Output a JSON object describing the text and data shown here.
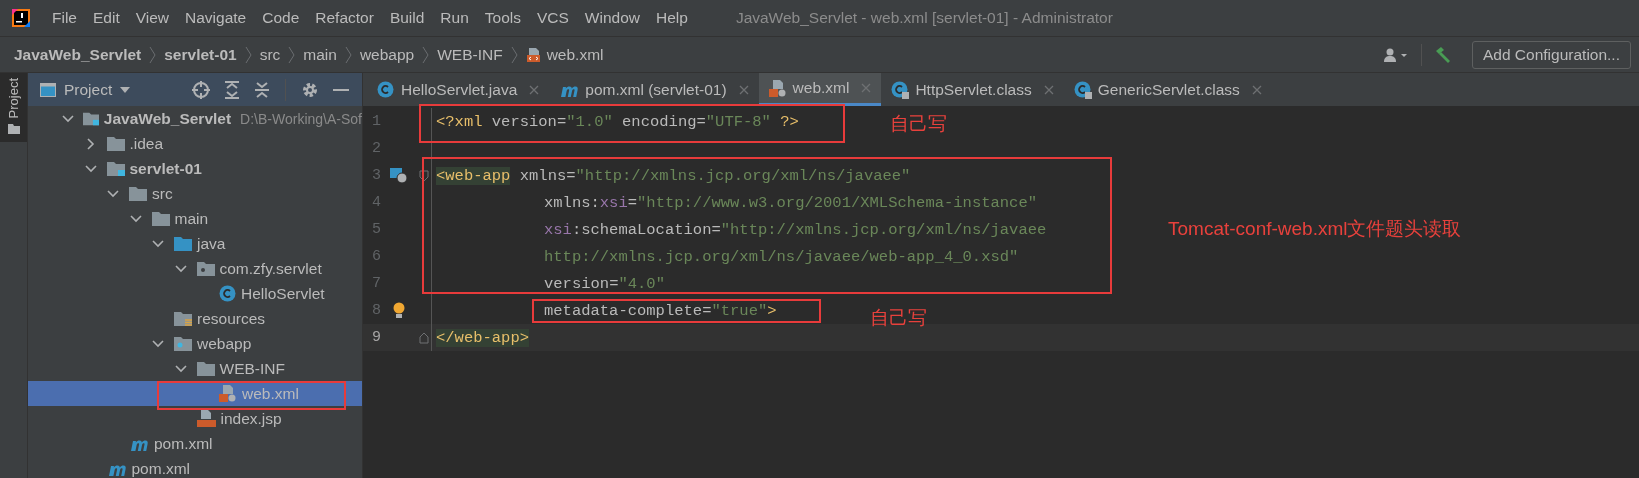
{
  "menu": {
    "items": [
      "File",
      "Edit",
      "View",
      "Navigate",
      "Code",
      "Refactor",
      "Build",
      "Run",
      "Tools",
      "VCS",
      "Window",
      "Help"
    ]
  },
  "window": {
    "title": "JavaWeb_Servlet - web.xml [servlet-01] - Administrator"
  },
  "breadcrumb": [
    {
      "label": "JavaWeb_Servlet",
      "kind": "module"
    },
    {
      "label": "servlet-01",
      "kind": "module"
    },
    {
      "label": "src",
      "kind": "folder"
    },
    {
      "label": "main",
      "kind": "folder"
    },
    {
      "label": "webapp",
      "kind": "folder"
    },
    {
      "label": "WEB-INF",
      "kind": "folder"
    },
    {
      "label": "web.xml",
      "kind": "xml"
    }
  ],
  "toolbar": {
    "run_config_button": "Add Configuration..."
  },
  "side_strip": {
    "tab": "Project"
  },
  "project_panel": {
    "title": "Project",
    "tree": [
      {
        "label": "JavaWeb_Servlet",
        "hint": "D:\\B-Working\\A-Sof",
        "kind": "module",
        "expanded": true,
        "selected": false,
        "children": [
          {
            "label": ".idea",
            "kind": "folder",
            "expanded": false,
            "selected": false
          },
          {
            "label": "servlet-01",
            "kind": "module",
            "expanded": true,
            "selected": false,
            "children": [
              {
                "label": "src",
                "kind": "folder",
                "expanded": true,
                "selected": false,
                "children": [
                  {
                    "label": "main",
                    "kind": "folder",
                    "expanded": true,
                    "selected": false,
                    "children": [
                      {
                        "label": "java",
                        "kind": "source-folder",
                        "expanded": true,
                        "selected": false,
                        "children": [
                          {
                            "label": "com.zfy.servlet",
                            "kind": "package",
                            "expanded": true,
                            "selected": false,
                            "children": [
                              {
                                "label": "HelloServlet",
                                "kind": "class",
                                "selected": false
                              }
                            ]
                          }
                        ]
                      },
                      {
                        "label": "resources",
                        "kind": "resources",
                        "selected": false
                      },
                      {
                        "label": "webapp",
                        "kind": "web-folder",
                        "expanded": true,
                        "selected": false,
                        "children": [
                          {
                            "label": "WEB-INF",
                            "kind": "folder",
                            "expanded": true,
                            "selected": false,
                            "children": [
                              {
                                "label": "web.xml",
                                "kind": "xml",
                                "selected": true
                              }
                            ]
                          },
                          {
                            "label": "index.jsp",
                            "kind": "jsp",
                            "selected": false
                          }
                        ]
                      }
                    ]
                  }
                ]
              },
              {
                "label": "pom.xml",
                "kind": "maven",
                "selected": false
              }
            ]
          },
          {
            "label": "pom.xml",
            "kind": "maven",
            "selected": false
          }
        ]
      }
    ]
  },
  "tabs": [
    {
      "label": "HelloServlet.java",
      "kind": "class",
      "selected": false
    },
    {
      "label": "pom.xml (servlet-01)",
      "kind": "maven",
      "selected": false
    },
    {
      "label": "web.xml",
      "kind": "xml",
      "selected": true
    },
    {
      "label": "HttpServlet.class",
      "kind": "class-locked",
      "selected": false
    },
    {
      "label": "GenericServlet.class",
      "kind": "class-locked",
      "selected": false
    }
  ],
  "editor": {
    "lines": [
      {
        "number": "1",
        "indented": false,
        "current": false,
        "tokens": [
          {
            "text": "<?xml ",
            "kind": "pi"
          },
          {
            "text": "version",
            "kind": "attr"
          },
          {
            "text": "=",
            "kind": "punct"
          },
          {
            "text": "\"1.0\"",
            "kind": "value"
          },
          {
            "text": " encoding",
            "kind": "attr"
          },
          {
            "text": "=",
            "kind": "punct"
          },
          {
            "text": "\"UTF-8\"",
            "kind": "value"
          },
          {
            "text": " ?>",
            "kind": "pi"
          }
        ]
      },
      {
        "number": "2",
        "current": false
      },
      {
        "number": "3",
        "indented": false,
        "current": false,
        "tokens": [
          {
            "text": "<web-app",
            "kind": "tag-matched"
          },
          {
            "text": " xmlns",
            "kind": "attr"
          },
          {
            "text": "=",
            "kind": "punct"
          },
          {
            "text": "\"http://xmlns.jcp.org/xml/ns/javaee\"",
            "kind": "value"
          }
        ]
      },
      {
        "number": "4",
        "indented": true,
        "current": false,
        "tokens": [
          {
            "text": "xmlns:",
            "kind": "attr"
          },
          {
            "text": "xsi",
            "kind": "ns"
          },
          {
            "text": "=",
            "kind": "punct"
          },
          {
            "text": "\"http://www.w3.org/2001/XMLSchema-instance\"",
            "kind": "value"
          }
        ]
      },
      {
        "number": "5",
        "indented": true,
        "current": false,
        "tokens": [
          {
            "text": "xsi",
            "kind": "ns"
          },
          {
            "text": ":schemaLocation",
            "kind": "attr"
          },
          {
            "text": "=",
            "kind": "punct"
          },
          {
            "text": "\"http://xmlns.jcp.org/xml/ns/javaee",
            "kind": "value"
          }
        ]
      },
      {
        "number": "6",
        "indented": true,
        "current": false,
        "tokens": [
          {
            "text": "http://xmlns.jcp.org/xml/ns/javaee/web-app_4_0.xsd\"",
            "kind": "value"
          }
        ]
      },
      {
        "number": "7",
        "indented": true,
        "current": false,
        "tokens": [
          {
            "text": "version",
            "kind": "attr"
          },
          {
            "text": "=",
            "kind": "punct"
          },
          {
            "text": "\"4.0\"",
            "kind": "value"
          }
        ]
      },
      {
        "number": "8",
        "indented": true,
        "current": false,
        "tokens": [
          {
            "text": "metadata-complete",
            "kind": "attr"
          },
          {
            "text": "=",
            "kind": "punct"
          },
          {
            "text": "\"true\"",
            "kind": "value"
          },
          {
            "text": ">",
            "kind": "tag"
          }
        ]
      },
      {
        "number": "9",
        "indented": false,
        "current": true,
        "tokens": [
          {
            "text": "</web-app>",
            "kind": "tag-matched"
          }
        ]
      }
    ]
  },
  "annotations": [
    {
      "text": "自己写"
    },
    {
      "text": "Tomcat-conf-web.xml文件题头读取"
    },
    {
      "text": "自己写"
    }
  ]
}
